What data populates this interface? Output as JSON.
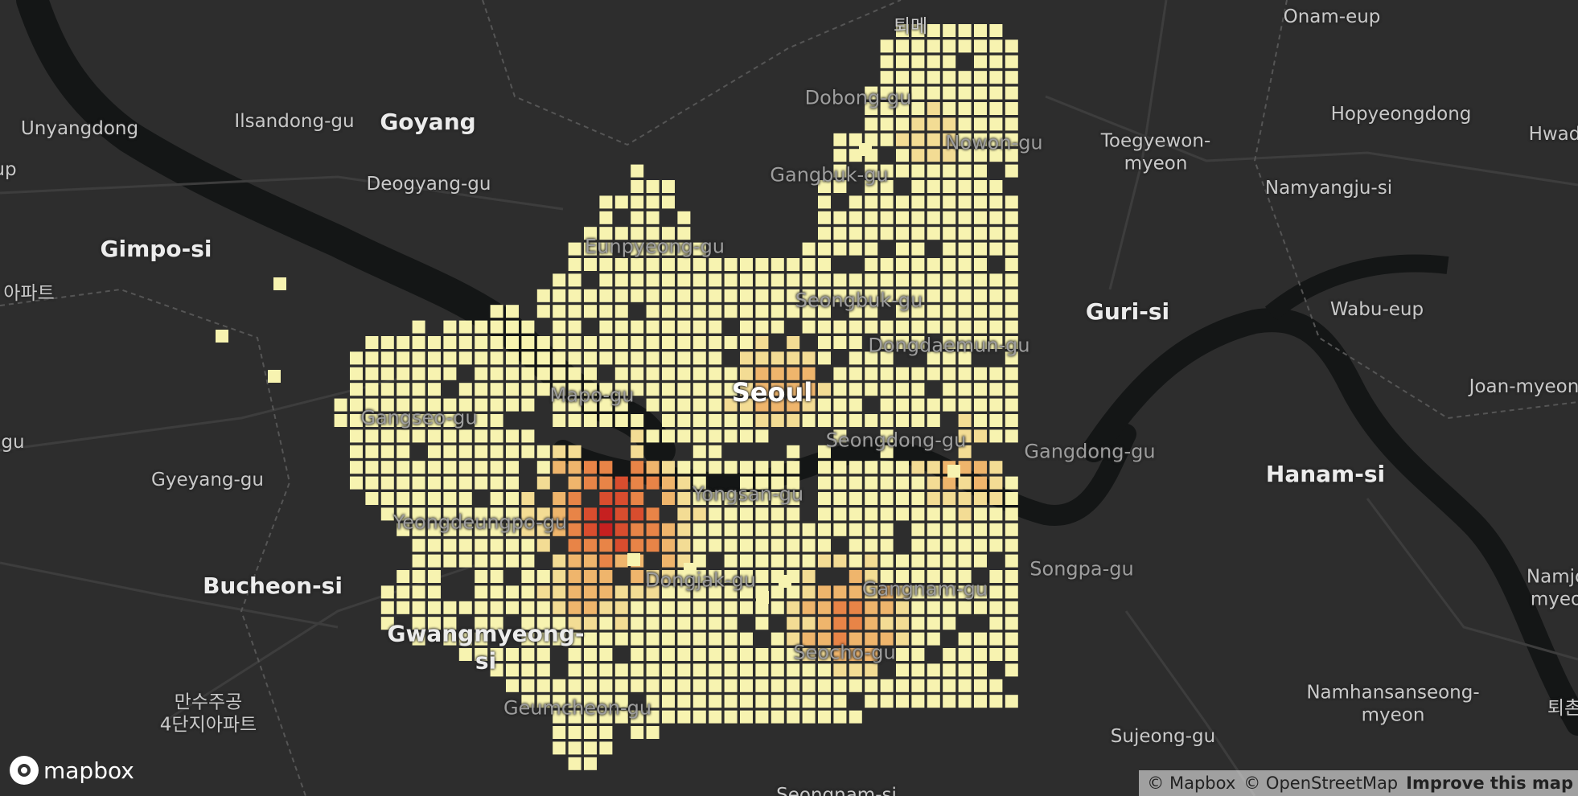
{
  "map": {
    "labels": [
      {
        "id": "toeme",
        "text": "퇴메",
        "pos": "n"
      },
      {
        "id": "onam",
        "text": "Onam-eup"
      },
      {
        "id": "unyang",
        "text": "Unyangdong"
      },
      {
        "id": "ilsan",
        "text": "Ilsandong-gu"
      },
      {
        "id": "goyang",
        "text": "Goyang"
      },
      {
        "id": "dobong",
        "text": "Dobong-gu"
      },
      {
        "id": "toegye",
        "text": "Toegyewon-\nmyeon"
      },
      {
        "id": "hopyeong",
        "text": "Hopyeongdong"
      },
      {
        "id": "hwado",
        "text": "Hwado"
      },
      {
        "id": "nowon",
        "text": "Nowon-gu"
      },
      {
        "id": "gangbuk",
        "text": "Gangbuk-gu"
      },
      {
        "id": "deogyang",
        "text": "Deogyang-gu"
      },
      {
        "id": "namyangju",
        "text": "Namyangju-si"
      },
      {
        "id": "eup",
        "text": "up"
      },
      {
        "id": "gimpo",
        "text": "Gimpo-si"
      },
      {
        "id": "eunpyeong",
        "text": "Eunpyeong-gu"
      },
      {
        "id": "apt1",
        "text": "아파트"
      },
      {
        "id": "seongbuk",
        "text": "Seongbuk-gu"
      },
      {
        "id": "guri",
        "text": "Guri-si"
      },
      {
        "id": "wabu",
        "text": "Wabu-eup"
      },
      {
        "id": "dongdaemun",
        "text": "Dongdaemun-gu"
      },
      {
        "id": "seoul",
        "text": "Seoul"
      },
      {
        "id": "mapo",
        "text": "Mapo-gu"
      },
      {
        "id": "joan",
        "text": "Joan-myeon"
      },
      {
        "id": "gangseo",
        "text": "Gangseo-gu"
      },
      {
        "id": "gu",
        "text": "gu"
      },
      {
        "id": "seongdong",
        "text": "Seongdong-gu"
      },
      {
        "id": "gangdong",
        "text": "Gangdong-gu"
      },
      {
        "id": "gyeyang",
        "text": "Gyeyang-gu"
      },
      {
        "id": "hanam",
        "text": "Hanam-si"
      },
      {
        "id": "yongsan",
        "text": "Yongsan-gu"
      },
      {
        "id": "yeongdeungpo",
        "text": "Yeongdeungpo-gu"
      },
      {
        "id": "songpa",
        "text": "Songpa-gu"
      },
      {
        "id": "dongjak",
        "text": "Dongjak-gu"
      },
      {
        "id": "gangnam",
        "text": "Gangnam-gu"
      },
      {
        "id": "bucheon",
        "text": "Bucheon-si"
      },
      {
        "id": "namjo",
        "text": "Namjo\nmyeo"
      },
      {
        "id": "gwangmyeong",
        "text": "Gwangmyeong-\nsi"
      },
      {
        "id": "seocho",
        "text": "Seocho-gu"
      },
      {
        "id": "namhansan",
        "text": "Namhansanseong-\nmyeon"
      },
      {
        "id": "mansu",
        "text": "만수주공\n4단지아파트"
      },
      {
        "id": "geumcheon",
        "text": "Geumcheon-gu"
      },
      {
        "id": "toe2",
        "text": "퇴촌"
      },
      {
        "id": "sujeong",
        "text": "Sujeong-gu"
      },
      {
        "id": "bottom1",
        "text": "Seongnam-si"
      }
    ],
    "grid": {
      "legend_colors": [
        "#f7f3b0",
        "#f3dc94",
        "#efb56c",
        "#e88447",
        "#d94d2e",
        "#c62020"
      ],
      "cell_color_default": "#f7f3b0",
      "high_density_colors": [
        "#f2d28c",
        "#eeb36a",
        "#e58948",
        "#d44d2e",
        "#c5211f"
      ]
    }
  },
  "logo": {
    "text": "mapbox"
  },
  "attribution": {
    "mapbox": "© Mapbox",
    "osm": "© OpenStreetMap",
    "improve": "Improve this map"
  }
}
